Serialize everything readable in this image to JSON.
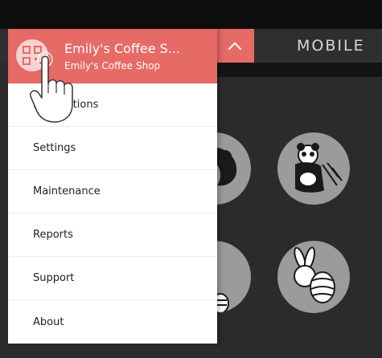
{
  "header": {
    "tab_label": "MOBILE"
  },
  "drawer": {
    "shop_title": "Emily's Coffee S...",
    "shop_subtitle": "Emily's Coffee Shop",
    "items": [
      {
        "label": "Notifications"
      },
      {
        "label": "Settings"
      },
      {
        "label": "Maintenance"
      },
      {
        "label": "Reports"
      },
      {
        "label": "Support"
      },
      {
        "label": "About"
      }
    ]
  },
  "colors": {
    "accent": "#e66a66",
    "background": "#2b2a2d",
    "tile": "#9b9b9b"
  }
}
